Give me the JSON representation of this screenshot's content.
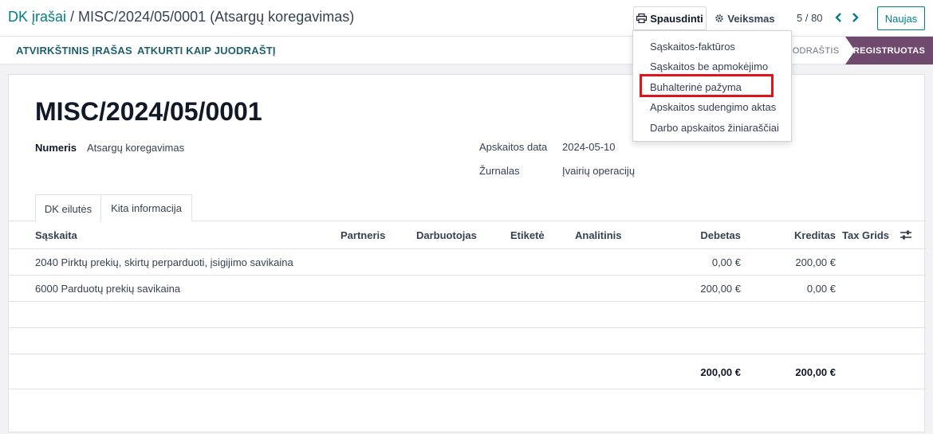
{
  "breadcrumb": {
    "parent": "DK įrašai",
    "separator": "/",
    "current": "MISC/2024/05/0001 (Atsargų koregavimas)"
  },
  "toolbar": {
    "print_label": "Spausdinti",
    "action_label": "Veiksmas",
    "pager": "5 / 80",
    "new_label": "Naujas"
  },
  "subbar": {
    "reverse_label": "ATVIRKŠTINIS ĮRAŠAS",
    "reset_label": "ATKURTI KAIP JUODRAŠTĮ",
    "status_draft": "JUODRAŠTIS",
    "status_posted": "REGISTRUOTAS"
  },
  "print_menu": {
    "items": [
      "Sąskaitos-faktūros",
      "Sąskaitos be apmokėjimo",
      "Buhalterinė pažyma",
      "Apskaitos sudengimo aktas",
      "Darbo apskaitos žiniaraščiai"
    ],
    "highlighted_index": 2
  },
  "form": {
    "name": "MISC/2024/05/0001",
    "number_label": "Numeris",
    "number_value": "Atsargų koregavimas",
    "date_label": "Apskaitos data",
    "date_value": "2024-05-10",
    "journal_label": "Žurnalas",
    "journal_value": "Įvairių operacijų"
  },
  "tabs": [
    "DK eilutės",
    "Kita informacija"
  ],
  "table": {
    "columns": {
      "account": "Sąskaita",
      "partner": "Partneris",
      "employee": "Darbuotojas",
      "label": "Etiketė",
      "analytic": "Analitinis",
      "debit": "Debetas",
      "credit": "Kreditas",
      "tax_grids": "Tax Grids"
    },
    "rows": [
      {
        "account": "2040 Pirktų prekių, skirtų perparduoti, įsigijimo savikaina",
        "debit": "0,00 €",
        "credit": "200,00 €"
      },
      {
        "account": "6000 Parduotų prekių savikaina",
        "debit": "200,00 €",
        "credit": "0,00 €"
      }
    ],
    "totals": {
      "debit": "200,00 €",
      "credit": "200,00 €"
    }
  },
  "colors": {
    "accent": "#017e84",
    "status": "#6f4a6e",
    "highlight": "#e1131b"
  }
}
